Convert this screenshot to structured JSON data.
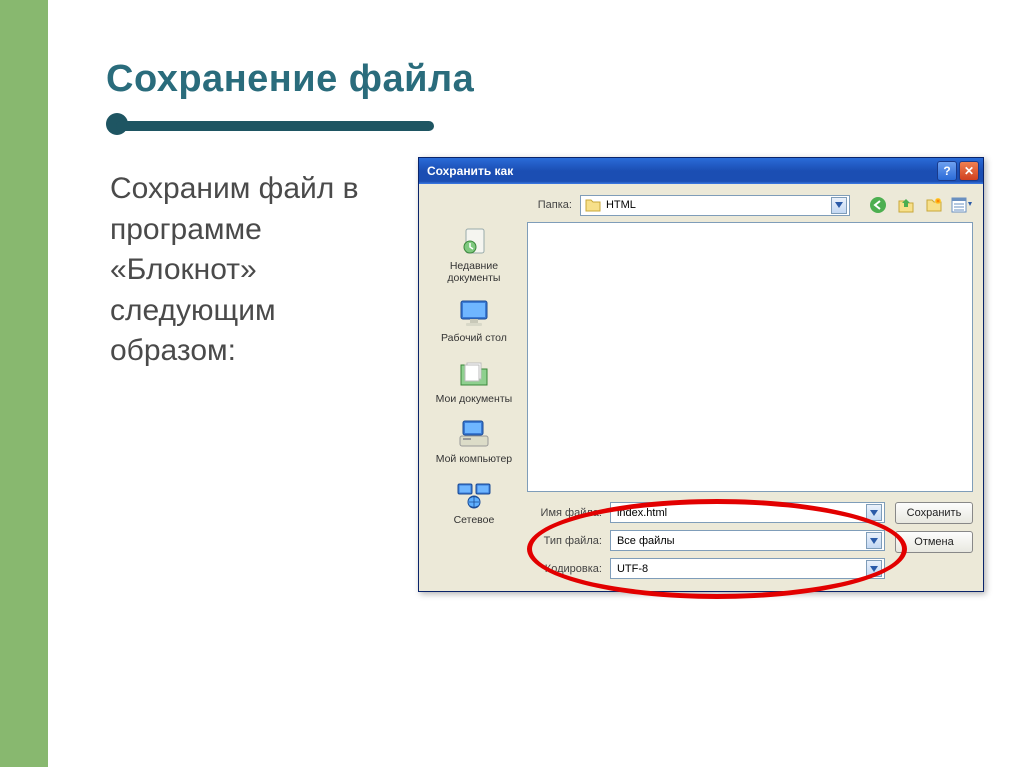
{
  "slide": {
    "title": "Сохранение файла",
    "body": "Сохраним файл в программе «Блокнот» следующим образом:"
  },
  "dialog": {
    "title": "Сохранить как",
    "folder_label": "Папка:",
    "folder_value": "HTML",
    "places": {
      "recent": "Недавние документы",
      "desktop": "Рабочий стол",
      "mydocs": "Мои документы",
      "mycomp": "Мой компьютер",
      "network": "Сетевое"
    },
    "filename_label": "Имя файла:",
    "filename_value": "index.html",
    "filetype_label": "Тип файла:",
    "filetype_value": "Все файлы",
    "encoding_label": "Кодировка:",
    "encoding_value": "UTF-8",
    "save_btn": "Сохранить",
    "cancel_btn": "Отмена"
  }
}
